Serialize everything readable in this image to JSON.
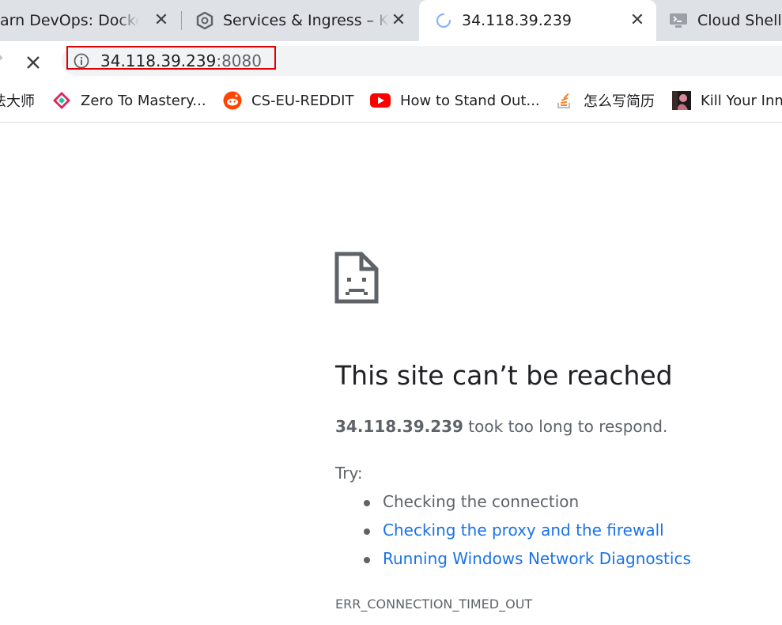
{
  "tabs": [
    {
      "title": "arn DevOps: Docker, K",
      "close": "✕",
      "icon": "none",
      "active": false
    },
    {
      "title": "Services & Ingress – Kub",
      "close": "✕",
      "icon": "gcp-hexagon-icon",
      "active": false
    },
    {
      "title": "34.118.39.239",
      "close": "✕",
      "icon": "loading-spinner-icon",
      "active": true
    },
    {
      "title": "Cloud Shell",
      "close": "",
      "icon": "cloud-shell-icon",
      "active": false
    }
  ],
  "toolbar": {
    "url_host": "34.118.39.239",
    "url_port": ":8080",
    "info_icon": "info-icon",
    "stop_icon": "stop-loading-icon"
  },
  "bookmarks": [
    {
      "label": "法大师",
      "icon": "none"
    },
    {
      "label": "Zero To Mastery...",
      "icon": "zero-to-mastery-icon"
    },
    {
      "label": "CS-EU-REDDIT",
      "icon": "reddit-icon"
    },
    {
      "label": "How to Stand Out...",
      "icon": "youtube-icon"
    },
    {
      "label": "怎么写简历",
      "icon": "stack-overflow-icon"
    },
    {
      "label": "Kill Your Inne",
      "icon": "thumbnail-icon"
    }
  ],
  "error": {
    "icon": "sad-page-icon",
    "heading": "This site can’t be reached",
    "host": "34.118.39.239",
    "description": " took too long to respond.",
    "try_label": "Try:",
    "suggestions": [
      {
        "text": "Checking the connection",
        "link": false
      },
      {
        "text": "Checking the proxy and the firewall",
        "link": true
      },
      {
        "text": "Running Windows Network Diagnostics",
        "link": true
      }
    ],
    "code": "ERR_CONNECTION_TIMED_OUT"
  },
  "colors": {
    "tabstrip": "#dee1e6",
    "link": "#1a73e8",
    "highlight": "#e00000",
    "reddit": "#ff4500",
    "youtube": "#ff0000"
  }
}
